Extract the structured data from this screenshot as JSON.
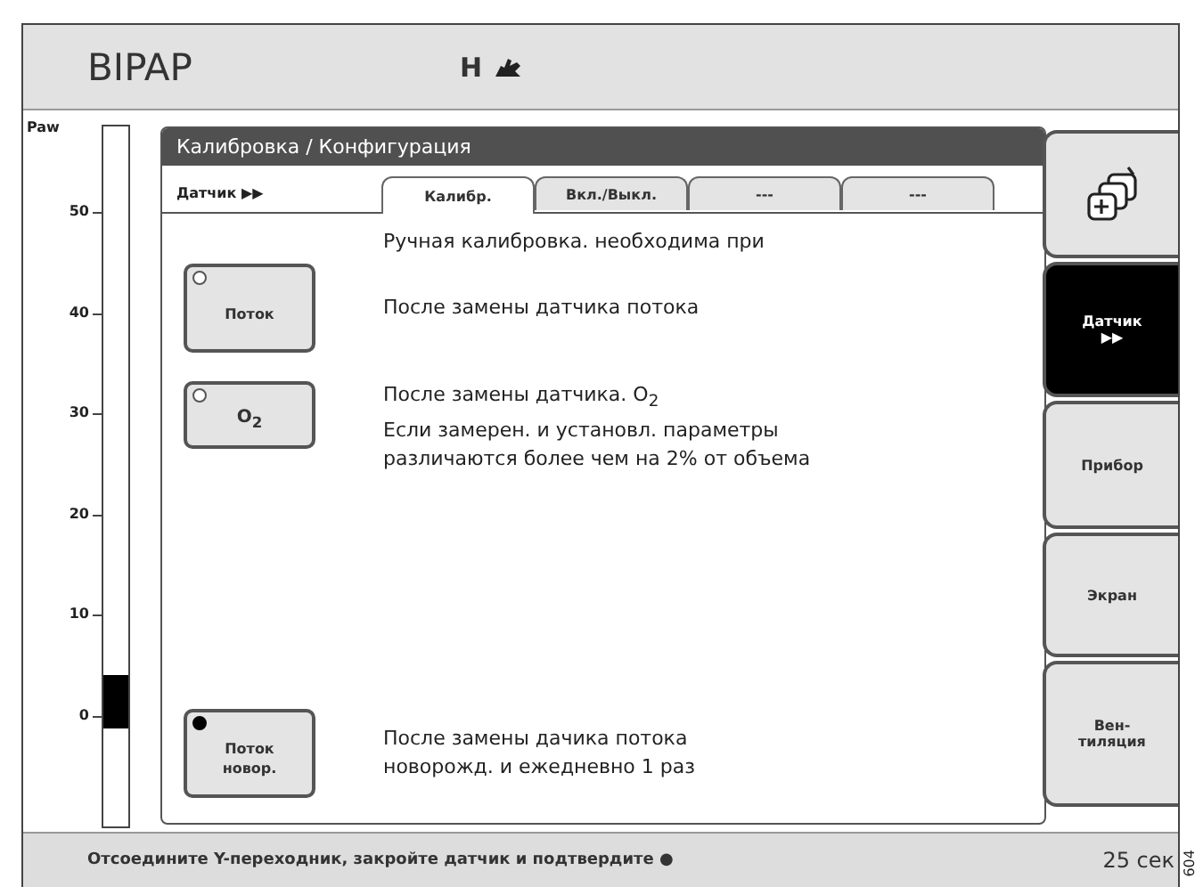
{
  "header": {
    "mode": "BIPAP",
    "patient": "H"
  },
  "gauge": {
    "label": "Paw",
    "ticks": [
      "50",
      "40",
      "30",
      "20",
      "10",
      "0"
    ]
  },
  "panel": {
    "title": "Калибровка / Конфигурация",
    "section": "Датчик ▶▶",
    "tabs": [
      {
        "label": "Калибр.",
        "selected": true
      },
      {
        "label": "Вкл./Выкл.",
        "selected": false
      },
      {
        "label": "---",
        "selected": false
      },
      {
        "label": "---",
        "selected": false
      }
    ],
    "intro": "Ручная калибровка. необходима при",
    "rows": [
      {
        "button": "Поток",
        "indicator_on": false,
        "lines": [
          "После замены датчика потока"
        ]
      },
      {
        "button": "O$_{2}$",
        "indicator_on": false,
        "lines": [
          "После замены датчика. O$_{2}$",
          "Если замерен. и установл. параметры",
          "различаются более чем на 2% от объема"
        ]
      },
      {
        "button": "Поток новор.",
        "indicator_on": true,
        "lines": [
          "После замены дачика потока",
          "новорожд. и ежедневно 1 раз"
        ]
      }
    ]
  },
  "side_tabs": [
    {
      "kind": "icon",
      "selected": false
    },
    {
      "kind": "text",
      "label": "Датчик ▶▶",
      "selected": true
    },
    {
      "kind": "text",
      "label": "Прибор",
      "selected": false
    },
    {
      "kind": "text",
      "label": "Экран",
      "selected": false
    },
    {
      "kind": "text",
      "label": "Вен-тиляция",
      "selected": false
    }
  ],
  "status_bar": {
    "message": "Отсоедините Y-переходник, закройте датчик и подтвердите ●",
    "timer": "25 сек"
  },
  "figure_number": "604"
}
